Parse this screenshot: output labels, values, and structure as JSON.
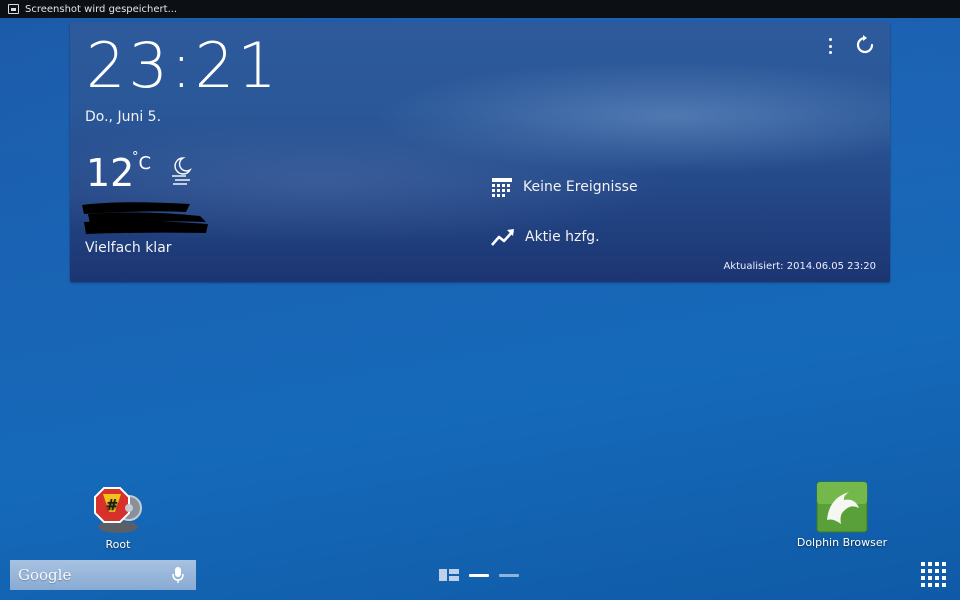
{
  "status_bar": {
    "notification": "Screenshot wird gespeichert..."
  },
  "widget": {
    "clock": "23:21",
    "date": "Do., Juni 5.",
    "temperature": "12",
    "temperature_unit": "C",
    "condition": "Vielfach klar",
    "events": "Keine Ereignisse",
    "stocks": "Aktie hzfg.",
    "updated": "Aktualisiert: 2014.06.05 23:20",
    "weather_icon": "night-clear-moon-icon",
    "menu_icon": "overflow-menu-icon",
    "refresh_icon": "refresh-icon"
  },
  "apps": [
    {
      "label": "Root",
      "icon": "root-superuser-icon"
    },
    {
      "label": "Dolphin Browser",
      "icon": "dolphin-icon"
    }
  ],
  "search": {
    "label": "Google",
    "mic_icon": "microphone-icon"
  },
  "colors": {
    "wallpaper": "#1a63b4",
    "widget_bg": "#2a5798",
    "status_bar": "#0c0f14",
    "dolphin_green": "#5aa03a",
    "root_red": "#d8302a"
  }
}
